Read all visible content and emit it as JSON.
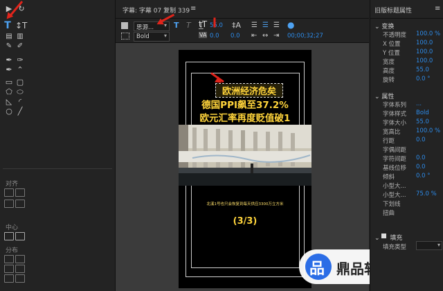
{
  "center": {
    "tab_title": "字幕: 字幕 07 复制 339",
    "menu_glyph": "≡",
    "font_name": "思源...",
    "font_style": "Bold",
    "font_size": "55.0",
    "tracking": "0.0",
    "leading": "0.0",
    "timecode": "00;00;32;27"
  },
  "subtitle": {
    "line1": "欧洲经济危矣",
    "line2": "德国PPI飙至37.2%",
    "line3": "欧元汇率再度贬值破1",
    "caption": "北溪1号也只会恢复到每天供应3300万立方米",
    "page": "(3/3)"
  },
  "left_panel": {
    "align_label": "对齐",
    "center_label": "中心",
    "distribute_label": "分布"
  },
  "props": {
    "title": "旧版标题属性",
    "menu_glyph": "≡",
    "transform_section": "变换",
    "rows_transform": [
      {
        "label": "不透明度",
        "value": "100.0 %"
      },
      {
        "label": "X 位置",
        "value": "100.0"
      },
      {
        "label": "Y 位置",
        "value": "100.0"
      },
      {
        "label": "宽度",
        "value": "100.0"
      },
      {
        "label": "高度",
        "value": "55.0"
      },
      {
        "label": "旋转",
        "value": "0.0 °"
      }
    ],
    "attr_section": "属性",
    "rows_attr": [
      {
        "label": "字体系列",
        "value": "..."
      },
      {
        "label": "字体样式",
        "value": "Bold"
      },
      {
        "label": "字体大小",
        "value": "55.0"
      },
      {
        "label": "宽高比",
        "value": "100.0 %"
      },
      {
        "label": "行距",
        "value": "0.0"
      },
      {
        "label": "字偶间距",
        "value": ""
      },
      {
        "label": "字符间距",
        "value": "0.0"
      },
      {
        "label": "基线位移",
        "value": "0.0"
      },
      {
        "label": "倾斜",
        "value": "0.0 °"
      },
      {
        "label": "小型大...",
        "value": ""
      },
      {
        "label": "小型大...",
        "value": "75.0 %"
      },
      {
        "label": "下划线",
        "value": ""
      },
      {
        "label": "扭曲",
        "value": ""
      }
    ],
    "fill_section": "填充",
    "fill_type_label": "填充类型"
  },
  "watermark": {
    "text": "鼎品软件"
  },
  "colors": {
    "accent_blue": "#2d8ceb",
    "subtitle_yellow": "#ffd43b",
    "annotation_red": "#e0241b"
  }
}
